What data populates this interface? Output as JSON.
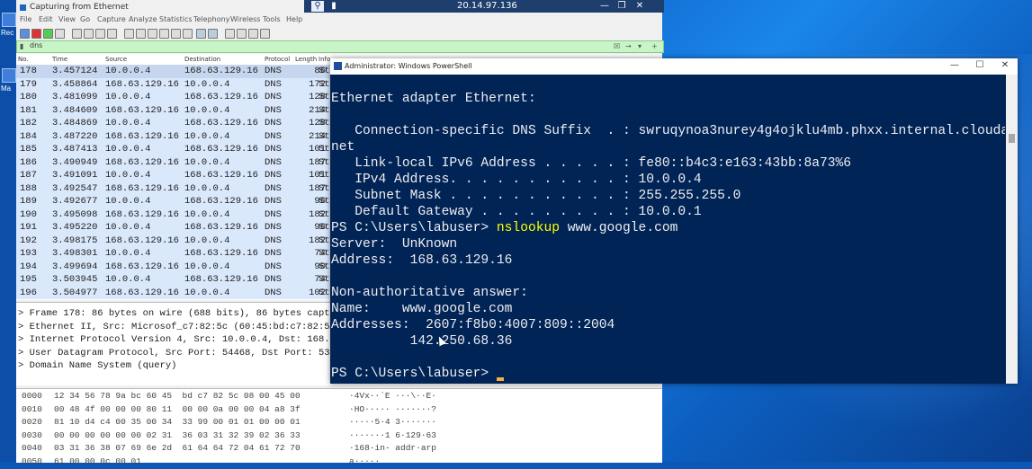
{
  "remote": {
    "title": "20.14.97.136"
  },
  "desktop": {
    "labels": [
      "Rec",
      "Ma"
    ]
  },
  "wireshark": {
    "title": "Capturing from Ethernet",
    "menu": [
      "File",
      "Edit",
      "View",
      "Go",
      "Capture",
      "Analyze",
      "Statistics",
      "Telephony",
      "Wireless",
      "Tools",
      "Help"
    ],
    "filter": "dns",
    "columns": [
      "No.",
      "Time",
      "Source",
      "Destination",
      "Protocol",
      "Length",
      "Info"
    ],
    "packets": [
      {
        "no": "178",
        "time": "3.457124",
        "src": "10.0.0.4",
        "dst": "168.63.129.16",
        "proto": "DNS",
        "len": "86",
        "info": "St"
      },
      {
        "no": "179",
        "time": "3.458864",
        "src": "168.63.129.16",
        "dst": "10.0.0.4",
        "proto": "DNS",
        "len": "172",
        "info": "St"
      },
      {
        "no": "180",
        "time": "3.481099",
        "src": "10.0.0.4",
        "dst": "168.63.129.16",
        "proto": "DNS",
        "len": "128",
        "info": "St"
      },
      {
        "no": "181",
        "time": "3.484609",
        "src": "168.63.129.16",
        "dst": "10.0.0.4",
        "proto": "DNS",
        "len": "214",
        "info": "St"
      },
      {
        "no": "182",
        "time": "3.484869",
        "src": "10.0.0.4",
        "dst": "168.63.129.16",
        "proto": "DNS",
        "len": "128",
        "info": "St"
      },
      {
        "no": "184",
        "time": "3.487220",
        "src": "168.63.129.16",
        "dst": "10.0.0.4",
        "proto": "DNS",
        "len": "214",
        "info": "St"
      },
      {
        "no": "185",
        "time": "3.487413",
        "src": "10.0.0.4",
        "dst": "168.63.129.16",
        "proto": "DNS",
        "len": "101",
        "info": "St"
      },
      {
        "no": "186",
        "time": "3.490949",
        "src": "168.63.129.16",
        "dst": "10.0.0.4",
        "proto": "DNS",
        "len": "187",
        "info": "St"
      },
      {
        "no": "187",
        "time": "3.491091",
        "src": "10.0.0.4",
        "dst": "168.63.129.16",
        "proto": "DNS",
        "len": "101",
        "info": "St"
      },
      {
        "no": "188",
        "time": "3.492547",
        "src": "168.63.129.16",
        "dst": "10.0.0.4",
        "proto": "DNS",
        "len": "187",
        "info": "St"
      },
      {
        "no": "189",
        "time": "3.492677",
        "src": "10.0.0.4",
        "dst": "168.63.129.16",
        "proto": "DNS",
        "len": "96",
        "info": "St"
      },
      {
        "no": "190",
        "time": "3.495098",
        "src": "168.63.129.16",
        "dst": "10.0.0.4",
        "proto": "DNS",
        "len": "182",
        "info": "St"
      },
      {
        "no": "191",
        "time": "3.495220",
        "src": "10.0.0.4",
        "dst": "168.63.129.16",
        "proto": "DNS",
        "len": "96",
        "info": "St"
      },
      {
        "no": "192",
        "time": "3.498175",
        "src": "168.63.129.16",
        "dst": "10.0.0.4",
        "proto": "DNS",
        "len": "182",
        "info": "St"
      },
      {
        "no": "193",
        "time": "3.498301",
        "src": "10.0.0.4",
        "dst": "168.63.129.16",
        "proto": "DNS",
        "len": "74",
        "info": "St"
      },
      {
        "no": "194",
        "time": "3.499694",
        "src": "168.63.129.16",
        "dst": "10.0.0.4",
        "proto": "DNS",
        "len": "90",
        "info": "St"
      },
      {
        "no": "195",
        "time": "3.503945",
        "src": "10.0.0.4",
        "dst": "168.63.129.16",
        "proto": "DNS",
        "len": "74",
        "info": "St"
      },
      {
        "no": "196",
        "time": "3.504977",
        "src": "168.63.129.16",
        "dst": "10.0.0.4",
        "proto": "DNS",
        "len": "102",
        "info": "St"
      }
    ],
    "details": [
      "> Frame 178: 86 bytes on wire (688 bits), 86 bytes captur",
      "> Ethernet II, Src: Microsof_c7:82:5c (60:45:bd:c7:82:5c),",
      "> Internet Protocol Version 4, Src: 10.0.0.4, Dst: 168.63.",
      "> User Datagram Protocol, Src Port: 54468, Dst Port: 53",
      "> Domain Name System (query)"
    ],
    "bytes": [
      {
        "off": "0000",
        "hex": "12 34 56 78 9a bc 60 45  bd c7 82 5c 08 00 45 00",
        "ascii": "·4Vx··`E ···\\··E·"
      },
      {
        "off": "0010",
        "hex": "00 48 4f 00 00 00 80 11  00 00 0a 00 00 04 a8 3f",
        "ascii": "·HO····· ·······?"
      },
      {
        "off": "0020",
        "hex": "81 10 d4 c4 00 35 00 34  33 99 00 01 01 00 00 01",
        "ascii": "·····5·4 3·······"
      },
      {
        "off": "0030",
        "hex": "00 00 00 00 00 00 02 31  36 03 31 32 39 02 36 33",
        "ascii": "·······1 6·129·63"
      },
      {
        "off": "0040",
        "hex": "03 31 36 38 07 69 6e 2d  61 64 64 72 04 61 72 70",
        "ascii": "·168·in- addr·arp"
      },
      {
        "off": "0050",
        "hex": "61 00 00 0c 00 01",
        "ascii": "a·····"
      }
    ]
  },
  "powershell": {
    "title": "Administrator: Windows PowerShell",
    "lines": [
      {
        "t": ""
      },
      {
        "t": "Ethernet adapter Ethernet:"
      },
      {
        "t": ""
      },
      {
        "t": "   Connection-specific DNS Suffix  . : swruqynoa3nurey4g4ojklu4mb.phxx.internal.cloudapp."
      },
      {
        "t": "net"
      },
      {
        "t": "   Link-local IPv6 Address . . . . . : fe80::b4c3:e163:43bb:8a73%6"
      },
      {
        "t": "   IPv4 Address. . . . . . . . . . . : 10.0.0.4"
      },
      {
        "t": "   Subnet Mask . . . . . . . . . . . : 255.255.255.0"
      },
      {
        "t": "   Default Gateway . . . . . . . . . : 10.0.0.1"
      },
      {
        "t": "PS C:\\Users\\labuser> ",
        "cmd": "nslookup",
        "arg": " www.google.com"
      },
      {
        "t": "Server:  UnKnown"
      },
      {
        "t": "Address:  168.63.129.16"
      },
      {
        "t": ""
      },
      {
        "t": "Non-authoritative answer:"
      },
      {
        "t": "Name:    www.google.com"
      },
      {
        "t": "Addresses:  2607:f8b0:4007:809::2004"
      },
      {
        "t": "          142.250.68.36"
      },
      {
        "t": ""
      },
      {
        "t": "PS C:\\Users\\labuser> "
      }
    ]
  }
}
